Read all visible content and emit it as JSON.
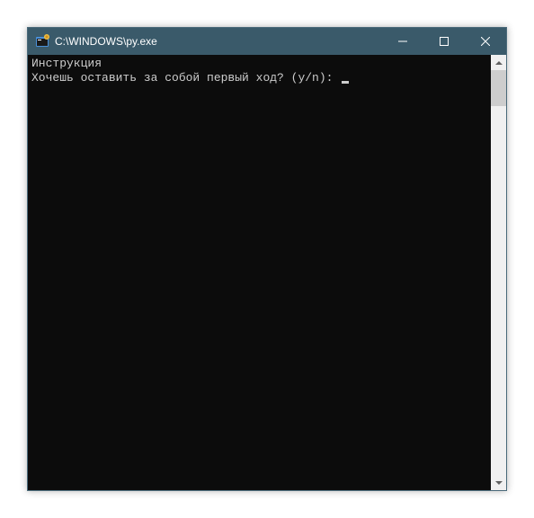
{
  "window": {
    "title": "C:\\WINDOWS\\py.exe"
  },
  "terminal": {
    "line1": "Инструкция",
    "line2": "Хочешь оставить за собой первый ход? (y/n): "
  }
}
